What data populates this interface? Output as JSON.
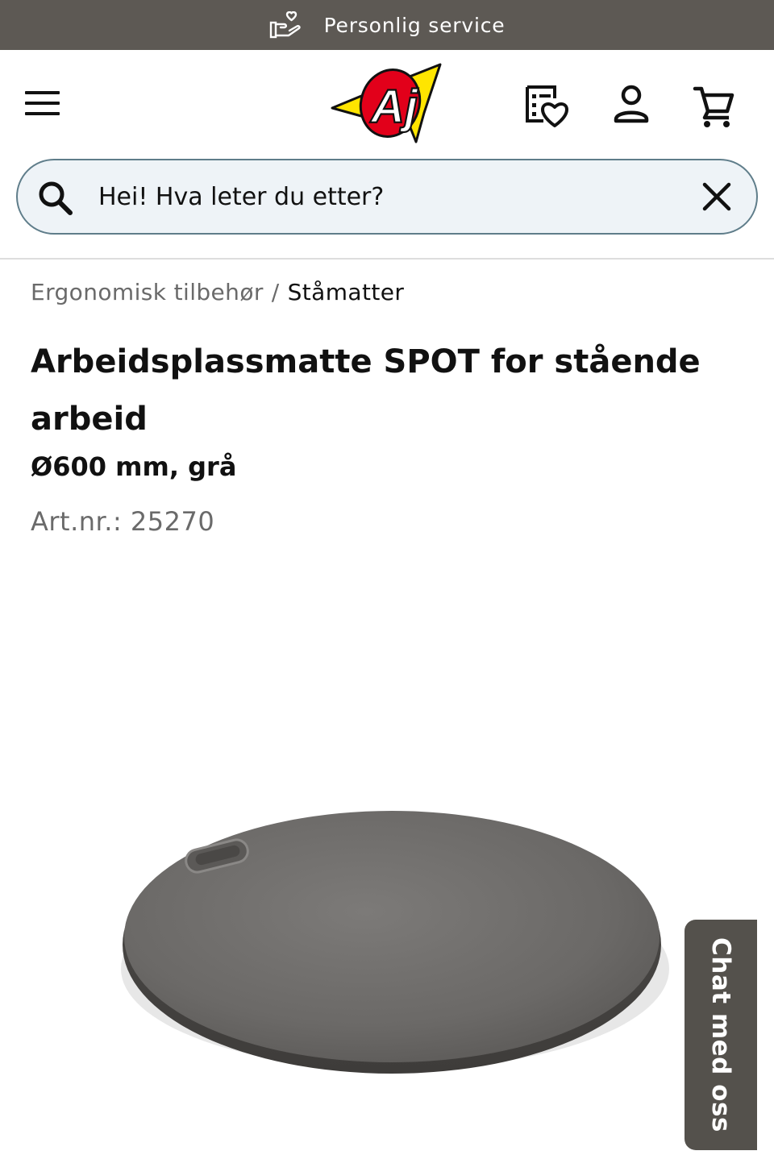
{
  "service_bar": {
    "text": "Personlig service",
    "icon": "heart-hand-icon",
    "background": "#5d5954"
  },
  "header": {
    "menu_icon": "hamburger-menu-icon",
    "logo_text": "Aj",
    "icons": [
      "wishlist-heart-icon",
      "account-icon",
      "cart-icon"
    ]
  },
  "search": {
    "placeholder": "Hei! Hva leter du etter?",
    "value": "",
    "icon": "search-icon",
    "clear_icon": "close-icon",
    "border_color": "#5f7d8a",
    "background": "#eef3f7"
  },
  "breadcrumb": {
    "parent": "Ergonomisk tilbehør",
    "separator": "/",
    "current": "Ståmatter"
  },
  "product": {
    "title": "Arbeidsplassmatte SPOT for stående arbeid",
    "subtitle": "Ø600 mm, grå",
    "art_nr": "Art.nr.: 25270",
    "image": "round-grey-standing-mat"
  },
  "chat": {
    "label": "Chat med oss",
    "background": "#54514c"
  },
  "colors": {
    "logo_red": "#e2001a",
    "logo_yellow": "#ffe500"
  }
}
